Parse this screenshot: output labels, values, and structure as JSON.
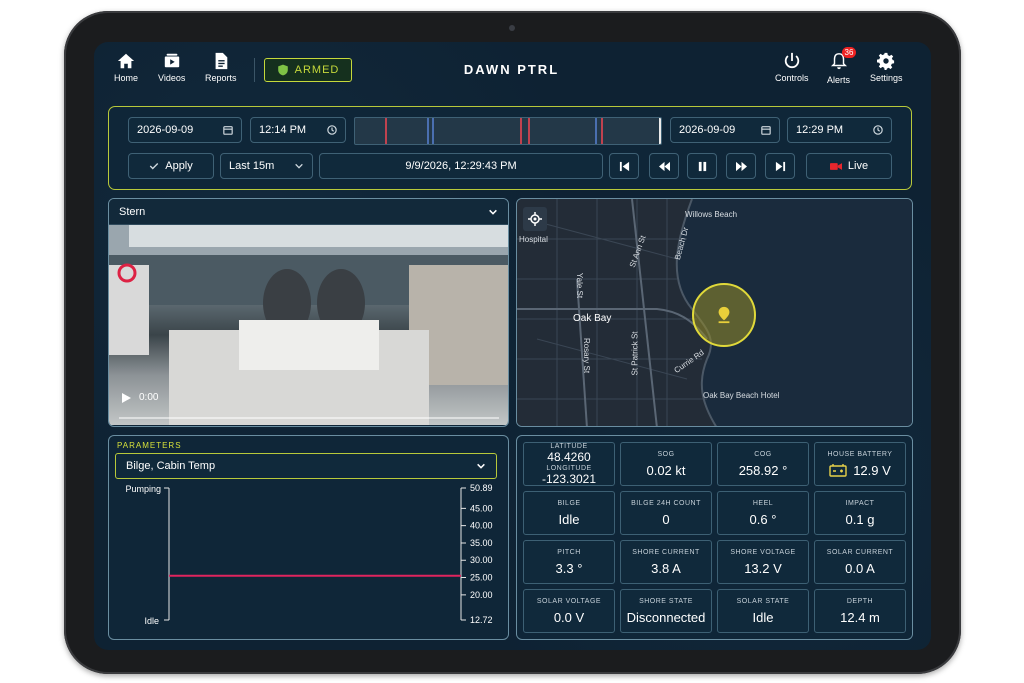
{
  "app": {
    "title": "DAWN PTRL",
    "armed_label": "ARMED"
  },
  "nav": {
    "home": "Home",
    "videos": "Videos",
    "reports": "Reports",
    "controls": "Controls",
    "alerts": "Alerts",
    "alerts_count": "36",
    "settings": "Settings"
  },
  "timeline": {
    "start_date": "2026-09-09",
    "start_time": "12:14 PM",
    "end_date": "2026-09-09",
    "end_time": "12:29 PM",
    "apply_label": "Apply",
    "range_label": "Last 15m",
    "current_timestamp": "9/9/2026, 12:29:43 PM",
    "live_label": "Live"
  },
  "video": {
    "camera_name": "Stern",
    "time": "0:00"
  },
  "map": {
    "labels": {
      "hospital": "Hospital",
      "willows_beach": "Willows Beach",
      "oak_bay": "Oak Bay",
      "oak_bay_hotel": "Oak Bay Beach Hotel",
      "st_ann": "St Ann St",
      "beach_dr": "Beach Dr",
      "yale": "Yale St",
      "currie": "Currie Rd",
      "rosary": "Rosary St",
      "st_patrick": "St Patrick St"
    }
  },
  "parameters": {
    "section_label": "PARAMETERS",
    "selected": "Bilge, Cabin Temp",
    "left_axis_top": "Pumping",
    "left_axis_bottom": "Idle",
    "right_ticks": [
      "50.89",
      "45.00",
      "40.00",
      "35.00",
      "30.00",
      "25.00",
      "20.00",
      "12.72"
    ]
  },
  "chart_data": {
    "type": "line",
    "series": [
      {
        "values": [
          25.5,
          25.5
        ]
      }
    ],
    "ylim": [
      12.72,
      50.89
    ]
  },
  "telemetry": {
    "latitude_label": "LATITUDE",
    "latitude": "48.4260",
    "longitude_label": "LONGITUDE",
    "longitude": "-123.3021",
    "tiles": [
      {
        "label": "SOG",
        "value": "0.02 kt"
      },
      {
        "label": "COG",
        "value": "258.92 °"
      },
      {
        "label": "HOUSE BATTERY",
        "value": "12.9 V"
      },
      {
        "label": "BILGE",
        "value": "Idle"
      },
      {
        "label": "BILGE 24H COUNT",
        "value": "0"
      },
      {
        "label": "HEEL",
        "value": "0.6 °"
      },
      {
        "label": "IMPACT",
        "value": "0.1 g"
      },
      {
        "label": "PITCH",
        "value": "3.3 °"
      },
      {
        "label": "SHORE CURRENT",
        "value": "3.8 A"
      },
      {
        "label": "SHORE VOLTAGE",
        "value": "13.2 V"
      },
      {
        "label": "SOLAR CURRENT",
        "value": "0.0 A"
      },
      {
        "label": "SOLAR VOLTAGE",
        "value": "0.0 V"
      },
      {
        "label": "SHORE STATE",
        "value": "Disconnected"
      },
      {
        "label": "SOLAR STATE",
        "value": "Idle"
      },
      {
        "label": "DEPTH",
        "value": "12.4 m"
      }
    ]
  },
  "colors": {
    "accent": "#c6d93b",
    "live": "#e8262d",
    "chart_line": "#e0245e"
  }
}
